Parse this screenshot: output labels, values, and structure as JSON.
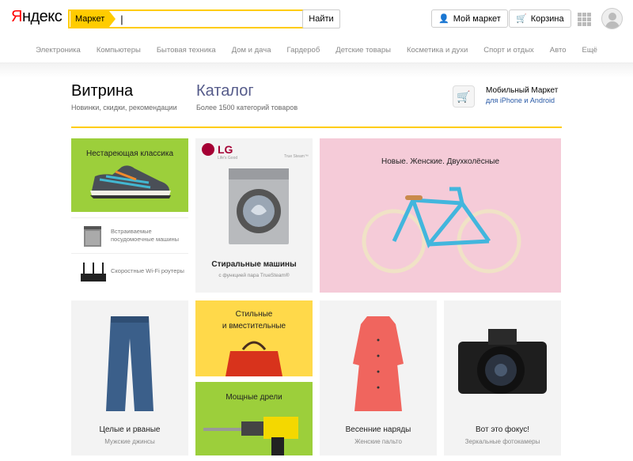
{
  "header": {
    "logo": "Яндекс",
    "search_tag": "Маркет",
    "search_value": "|",
    "find_button": "Найти",
    "my_market_button": "Мой маркет",
    "cart_button": "Корзина"
  },
  "nav": [
    "Электроника",
    "Компьютеры",
    "Бытовая техника",
    "Дом и дача",
    "Гардероб",
    "Детские товары",
    "Косметика и духи",
    "Спорт и отдых",
    "Авто",
    "Ещё"
  ],
  "sections": {
    "showcase": {
      "title": "Витрина",
      "subtitle": "Новинки, скидки, рекомендации"
    },
    "catalog": {
      "title": "Каталог",
      "subtitle": "Более 1500 категорий товаров"
    },
    "mobile": {
      "title": "Мобильный Маркет",
      "link": "для iPhone и Android"
    }
  },
  "tiles": {
    "classics": "Нестареющая классика",
    "dishwashers": "Встраиваемые посудомоечные машины",
    "routers": "Скоростные Wi-Fi роутеры",
    "lg_logo": "LG",
    "lg_sub": "Life's Good",
    "true_steam": "True Steam™",
    "washers_title": "Стиральные машины",
    "washers_sub": "с функцией пара TrueSteam®",
    "bikes": "Новые. Женские. Двухколёсные",
    "jeans_title": "Целые и рваные",
    "jeans_sub": "Мужские джинсы",
    "bags_title_1": "Стильные",
    "bags_title_2": "и вместительные",
    "drills": "Мощные дрели",
    "dresses_title": "Весенние наряды",
    "dresses_sub": "Женские пальто",
    "camera_title": "Вот это фокус!",
    "camera_sub": "Зеркальные фотокамеры"
  },
  "colors": {
    "accent": "#ffcc00",
    "lime": "#9ccf3b",
    "pink": "#f5cbd8",
    "yellow": "#ffd94a",
    "catalog": "#555b8a"
  }
}
